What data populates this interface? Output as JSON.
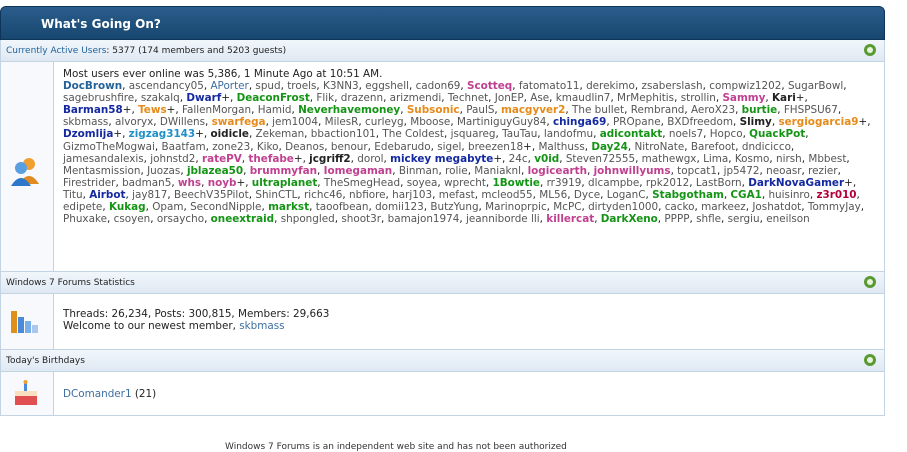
{
  "header": {
    "title": "What's Going On?"
  },
  "active": {
    "label": "Currently Active Users",
    "count": ": 5377 (174 members and 5203 guests)",
    "record": "Most users ever online was 5,386, 1 Minute Ago at 10:51 AM.",
    "users": [
      [
        "DocBrown",
        "b"
      ],
      [
        "ascendancy05",
        ""
      ],
      [
        "APorter",
        "l"
      ],
      [
        "spud",
        ""
      ],
      [
        "troels",
        ""
      ],
      [
        "K3NN3",
        ""
      ],
      [
        "eggshell",
        ""
      ],
      [
        "cadon69",
        ""
      ],
      [
        "Scotteq",
        "m"
      ],
      [
        "fatomato11",
        ""
      ],
      [
        "derekimo",
        ""
      ],
      [
        "zsaberslash",
        ""
      ],
      [
        "compwiz1202",
        ""
      ],
      [
        "SugarBowl",
        ""
      ],
      [
        "sagebrushfire",
        ""
      ],
      [
        "szakalq",
        ""
      ],
      [
        "Dwarf",
        "d",
        "+"
      ],
      [
        "DeaconFrost",
        "g"
      ],
      [
        "Flik",
        ""
      ],
      [
        "drazenn",
        ""
      ],
      [
        "arizmendi",
        ""
      ],
      [
        "Technet",
        ""
      ],
      [
        "JonEP",
        ""
      ],
      [
        "Ase",
        ""
      ],
      [
        "kmaudlin7",
        ""
      ],
      [
        "MrMephitis",
        ""
      ],
      [
        "strollin",
        ""
      ],
      [
        "Sammy",
        "m"
      ],
      [
        "Kari",
        "bl",
        "+"
      ],
      [
        "Barman58",
        "d",
        "+"
      ],
      [
        "Tews",
        "o",
        "+"
      ],
      [
        "FallenMorgan",
        ""
      ],
      [
        "Hamid",
        ""
      ],
      [
        "Neverhavemoney",
        "g"
      ],
      [
        "Subsonic",
        "o"
      ],
      [
        "PaulS",
        ""
      ],
      [
        "macgyver2",
        "o"
      ],
      [
        "The bullet",
        ""
      ],
      [
        "Rembrand",
        ""
      ],
      [
        "AeroX23",
        ""
      ],
      [
        "burtie",
        "g"
      ],
      [
        "FHSPSU67",
        ""
      ],
      [
        "skbmass",
        ""
      ],
      [
        "alvoryx",
        ""
      ],
      [
        "DWillens",
        ""
      ],
      [
        "swarfega",
        "o"
      ],
      [
        "jem1004",
        ""
      ],
      [
        "MilesR",
        ""
      ],
      [
        "curleyg",
        ""
      ],
      [
        "Mboose",
        ""
      ],
      [
        "MartiniguyGuy84",
        ""
      ],
      [
        "chinga69",
        "d"
      ],
      [
        "PROpane",
        ""
      ],
      [
        "BXDfreedom",
        ""
      ],
      [
        "Slimy",
        "bl"
      ],
      [
        "sergiogarcia9",
        "o",
        "+"
      ],
      [
        "Dzomlija",
        "d",
        "+"
      ],
      [
        "zigzag3143",
        "c",
        "+"
      ],
      [
        "oidicle",
        "bl"
      ],
      [
        "Zekeman",
        ""
      ],
      [
        "bbaction101",
        ""
      ],
      [
        "The Coldest",
        ""
      ],
      [
        "jsquareg",
        ""
      ],
      [
        "TauTau",
        ""
      ],
      [
        "landofmu",
        ""
      ],
      [
        "adicontakt",
        "g"
      ],
      [
        "noels7",
        ""
      ],
      [
        "Hopco",
        ""
      ],
      [
        "QuackPot",
        "g"
      ],
      [
        "GizmoTheMogwai",
        ""
      ],
      [
        "Baatfam",
        ""
      ],
      [
        "zone23",
        ""
      ],
      [
        "Kiko",
        ""
      ],
      [
        "Deanos",
        ""
      ],
      [
        "benour",
        ""
      ],
      [
        "Edebarudo",
        ""
      ],
      [
        "sigel",
        ""
      ],
      [
        "breezen18",
        "",
        "+"
      ],
      [
        "Malthuss",
        ""
      ],
      [
        "Day24",
        "g"
      ],
      [
        "NitroNate",
        ""
      ],
      [
        "Barefoot",
        ""
      ],
      [
        "dndicicco",
        ""
      ],
      [
        "jamesandalexis",
        ""
      ],
      [
        "johnstd2",
        ""
      ],
      [
        "ratePV",
        "m"
      ],
      [
        "thefabe",
        "m",
        "+"
      ],
      [
        "jcgriff2",
        "bl"
      ],
      [
        "dorol",
        ""
      ],
      [
        "mickey megabyte",
        "d",
        "+"
      ],
      [
        "24c",
        ""
      ],
      [
        "v0id",
        "g"
      ],
      [
        "Steven72555",
        ""
      ],
      [
        "mathewgx",
        ""
      ],
      [
        "Lima",
        ""
      ],
      [
        "Kosmo",
        ""
      ],
      [
        "nirsh",
        ""
      ],
      [
        "Mbbest",
        ""
      ],
      [
        "Mentasmission",
        ""
      ],
      [
        "Juozas",
        ""
      ],
      [
        "jblazea50",
        "g"
      ],
      [
        "brummyfan",
        "m"
      ],
      [
        "Iomegaman",
        "m"
      ],
      [
        "Binman",
        ""
      ],
      [
        "rolie",
        ""
      ],
      [
        "Maniaknl",
        ""
      ],
      [
        "logicearth",
        "m"
      ],
      [
        "johnwillyums",
        "m"
      ],
      [
        "topcat1",
        ""
      ],
      [
        "jp5472",
        ""
      ],
      [
        "neoasr",
        ""
      ],
      [
        "rezier",
        ""
      ],
      [
        "Firestrider",
        ""
      ],
      [
        "badman5",
        ""
      ],
      [
        "whs",
        "m"
      ],
      [
        "noyb",
        "m",
        "+"
      ],
      [
        "ultraplanet",
        "g"
      ],
      [
        "TheSmegHead",
        ""
      ],
      [
        "soyea",
        ""
      ],
      [
        "wprecht",
        ""
      ],
      [
        "1Bowtie",
        "g"
      ],
      [
        "rr3919",
        ""
      ],
      [
        "dlcampbe",
        ""
      ],
      [
        "rpk2012",
        ""
      ],
      [
        "LastBorn",
        ""
      ],
      [
        "DarkNovaGamer",
        "d",
        "+"
      ],
      [
        "Titu",
        ""
      ],
      [
        "Airbot",
        "d"
      ],
      [
        "jay817",
        ""
      ],
      [
        "BeechV35Pilot",
        ""
      ],
      [
        "ShinCTL",
        ""
      ],
      [
        "richc46",
        ""
      ],
      [
        "nbfiore",
        ""
      ],
      [
        "harj103",
        ""
      ],
      [
        "mefast",
        ""
      ],
      [
        "mcleod55",
        ""
      ],
      [
        "ML56",
        ""
      ],
      [
        "Dyce",
        ""
      ],
      [
        "LoganC",
        ""
      ],
      [
        "Stabgotham",
        "g"
      ],
      [
        "CGA1",
        "g"
      ],
      [
        "huisinro",
        ""
      ],
      [
        "z3r010",
        "r"
      ],
      [
        "edipete",
        ""
      ],
      [
        "Kukag",
        "g"
      ],
      [
        "Opam",
        ""
      ],
      [
        "SecondNipple",
        ""
      ],
      [
        "markst",
        "g"
      ],
      [
        "taoofbean",
        ""
      ],
      [
        "domii123",
        ""
      ],
      [
        "ButzYung",
        ""
      ],
      [
        "Marinoprpic",
        ""
      ],
      [
        "McPC",
        ""
      ],
      [
        "dirtyden1000",
        ""
      ],
      [
        "cacko",
        ""
      ],
      [
        "markeez",
        ""
      ],
      [
        "Joshatdot",
        ""
      ],
      [
        "TommyJay",
        ""
      ],
      [
        "Phuxake",
        ""
      ],
      [
        "csoyen",
        ""
      ],
      [
        "orsaycho",
        ""
      ],
      [
        "oneextraid",
        "g"
      ],
      [
        "shpongled",
        ""
      ],
      [
        "shoot3r",
        ""
      ],
      [
        "bamajon1974",
        ""
      ],
      [
        "jeanniborde lli",
        ""
      ],
      [
        "killercat",
        "m"
      ],
      [
        "DarkXeno",
        "g"
      ],
      [
        "PPPP",
        ""
      ],
      [
        "shfle",
        ""
      ],
      [
        "sergiu",
        ""
      ],
      [
        "eneilson",
        ""
      ]
    ]
  },
  "stats": {
    "label": "Windows 7 Forums Statistics",
    "line1": "Threads: 26,234, Posts: 300,815, Members: 29,663",
    "welcome": "Welcome to our newest member, ",
    "newest": "skbmass"
  },
  "birthdays": {
    "label": "Today's Birthdays",
    "name": "DComander1",
    "age": " (21)"
  },
  "footer": {
    "text": "Windows 7 Forums is an independent web site and has not been authorized"
  }
}
